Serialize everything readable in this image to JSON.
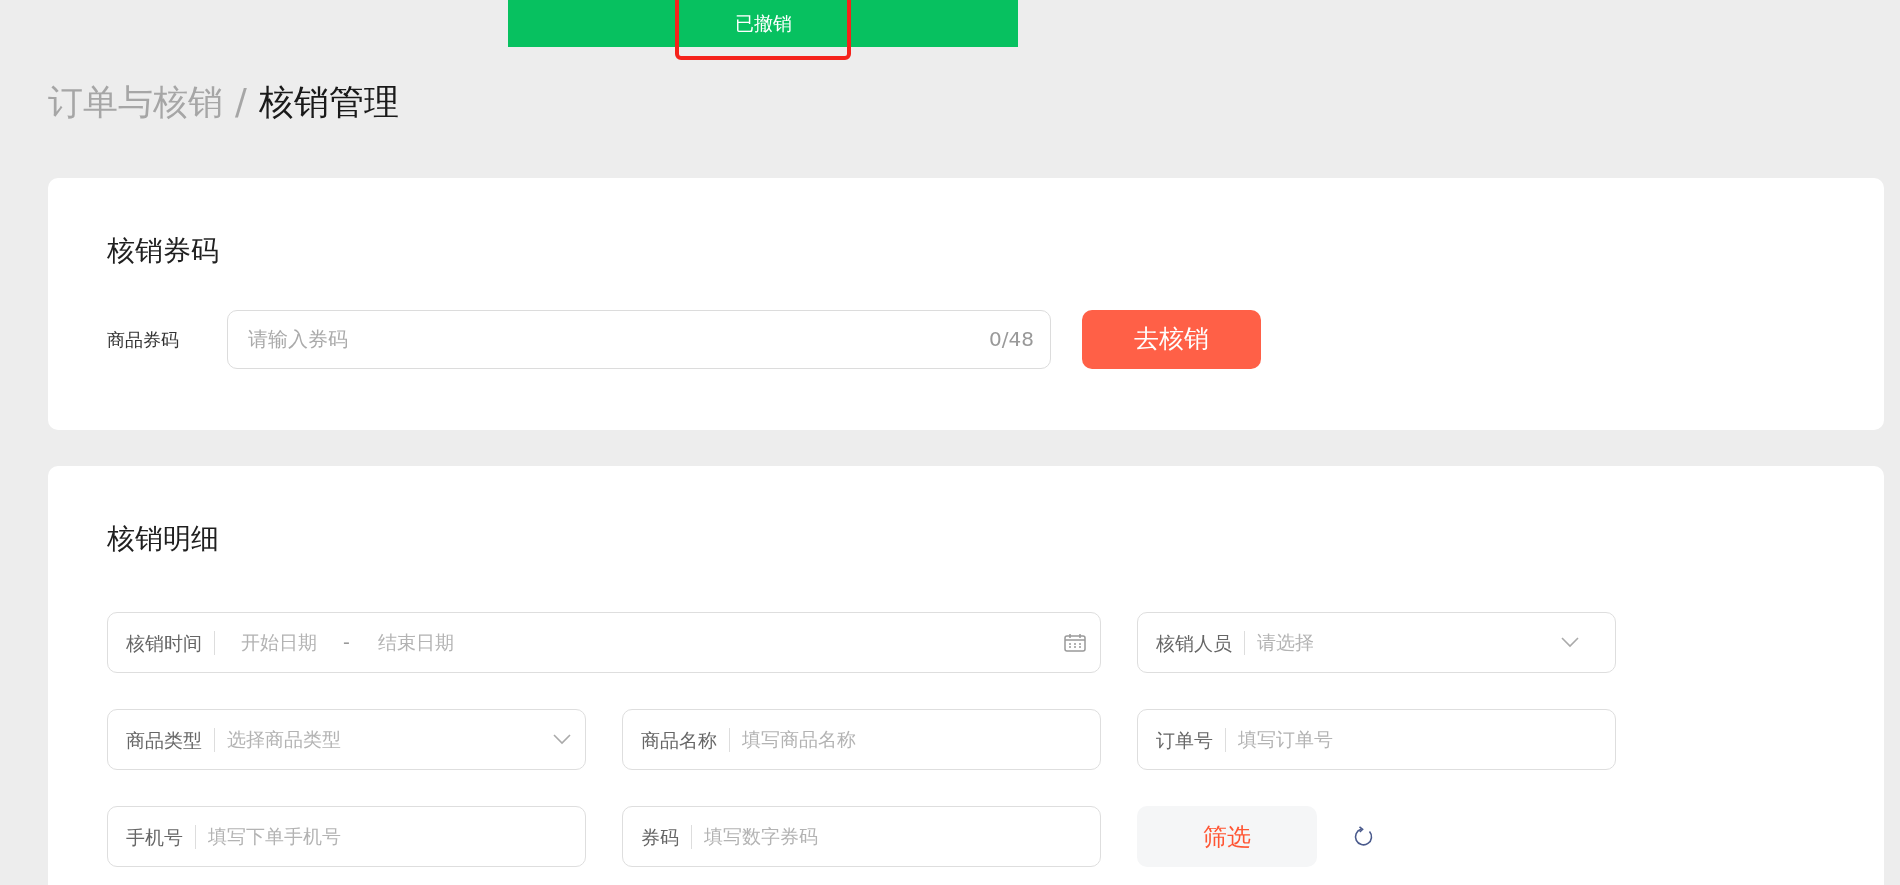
{
  "toast": {
    "text": "已撤销"
  },
  "breadcrumb": {
    "items": [
      {
        "label": "订单与核销",
        "current": false
      },
      {
        "label": "核销管理",
        "current": true
      }
    ],
    "separator": "/"
  },
  "redeem_card": {
    "title": "核销券码",
    "label": "商品券码",
    "input": {
      "placeholder": "请输入券码",
      "counter": "0/48"
    },
    "button": "去核销"
  },
  "detail_card": {
    "title": "核销明细",
    "filters": [
      {
        "kind": "date_range",
        "label": "核销时间",
        "start_placeholder": "开始日期",
        "separator": "-",
        "end_placeholder": "结束日期"
      },
      {
        "kind": "select",
        "label": "核销人员",
        "placeholder": "请选择"
      },
      {
        "kind": "select",
        "label": "商品类型",
        "placeholder": "选择商品类型"
      },
      {
        "kind": "text",
        "label": "商品名称",
        "placeholder": "填写商品名称"
      },
      {
        "kind": "text",
        "label": "订单号",
        "placeholder": "填写订单号"
      },
      {
        "kind": "text",
        "label": "手机号",
        "placeholder": "填写下单手机号"
      },
      {
        "kind": "text",
        "label": "券码",
        "placeholder": "填写数字券码"
      }
    ],
    "filter_button": "筛选"
  }
}
